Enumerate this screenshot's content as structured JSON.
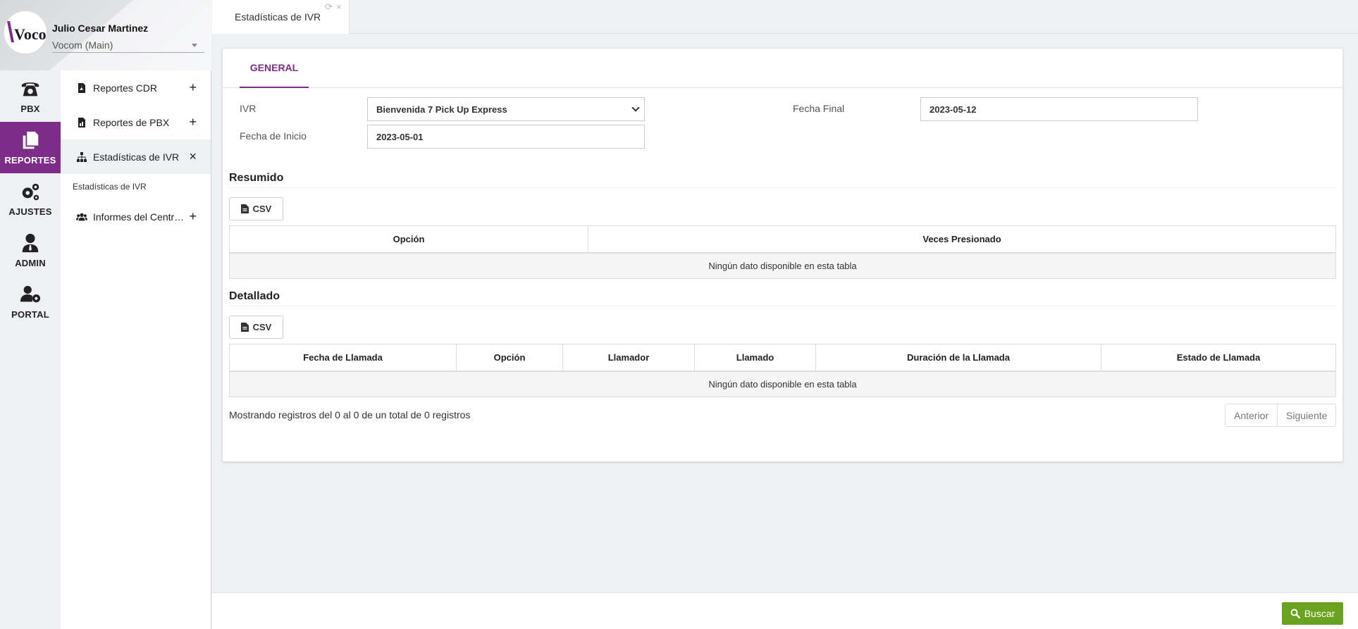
{
  "profile": {
    "user_name": "Julio Cesar Martinez",
    "organization": "Vocom (Main)",
    "logo_text": "Vocom"
  },
  "rail": {
    "items": [
      {
        "label": "PBX",
        "icon": "phone-icon"
      },
      {
        "label": "REPORTES",
        "icon": "documents-icon",
        "active": true
      },
      {
        "label": "AJUSTES",
        "icon": "gears-icon"
      },
      {
        "label": "ADMIN",
        "icon": "user-tie-icon"
      },
      {
        "label": "PORTAL",
        "icon": "user-gear-icon"
      }
    ]
  },
  "submenu": {
    "items": [
      {
        "label": "Reportes CDR",
        "icon": "pdf-file-icon",
        "action": "+"
      },
      {
        "label": "Reportes de PBX",
        "icon": "file-chart-icon",
        "action": "+"
      },
      {
        "label": "Estadísticas de IVR",
        "icon": "sitemap-icon",
        "action": "×",
        "active": true
      },
      {
        "label": "Informes del Centro de Llamadas",
        "icon": "users-icon",
        "action": "+"
      }
    ],
    "note": "Estadísticas de IVR"
  },
  "tabbar": {
    "tab_title": "Estadísticas de IVR",
    "refresh_glyph": "⟳",
    "close_glyph": "×"
  },
  "card": {
    "tab_general": "GENERAL",
    "form": {
      "ivr_label": "IVR",
      "ivr_value": "Bienvenida 7 Pick Up Express",
      "start_label": "Fecha de Inicio",
      "start_value": "2023-05-01",
      "end_label": "Fecha Final",
      "end_value": "2023-05-12"
    },
    "resumido": {
      "title": "Resumido",
      "csv_label": "CSV",
      "columns": [
        "Opción",
        "Veces Presionado"
      ],
      "empty_text": "Ningún dato disponible en esta tabla"
    },
    "detallado": {
      "title": "Detallado",
      "csv_label": "CSV",
      "columns": [
        "Fecha de Llamada",
        "Opción",
        "Llamador",
        "Llamado",
        "Duración de la Llamada",
        "Estado de Llamada"
      ],
      "empty_text": "Ningún dato disponible en esta tabla"
    },
    "records_info": "Mostrando registros del 0 al 0 de un total de 0 registros",
    "pager": {
      "prev": "Anterior",
      "next": "Siguiente"
    }
  },
  "footer": {
    "search_label": "Buscar"
  },
  "colors": {
    "accent": "#7b2d87",
    "search_button": "#6aa320"
  }
}
